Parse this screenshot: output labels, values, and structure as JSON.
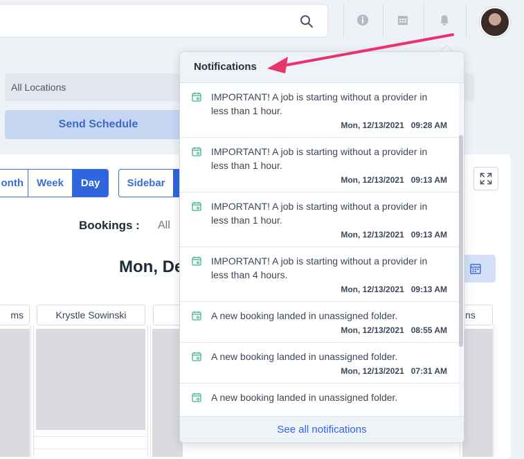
{
  "topbar": {
    "icons": [
      "search-icon",
      "info-icon",
      "calendar-grid-icon",
      "bell-icon"
    ]
  },
  "filters": {
    "location_value": "All Locations",
    "send_schedule_label": "Send Schedule"
  },
  "calendar": {
    "view_tabs": [
      {
        "label": "onth",
        "active": false
      },
      {
        "label": "Week",
        "active": false
      },
      {
        "label": "Day",
        "active": true
      }
    ],
    "sidebar_label": "Sidebar",
    "bookings_label": "Bookings :",
    "bookings_value": "All",
    "date_title": "Mon, De",
    "columns": [
      "ms",
      "Krystle Sowinski",
      "",
      "ns"
    ]
  },
  "notifications": {
    "title": "Notifications",
    "items": [
      {
        "message": "IMPORTANT! A job is starting without a provider in less than 1 hour.",
        "date": "Mon, 12/13/2021",
        "time": "09:28 AM"
      },
      {
        "message": "IMPORTANT! A job is starting without a provider in less than 1 hour.",
        "date": "Mon, 12/13/2021",
        "time": "09:13 AM"
      },
      {
        "message": "IMPORTANT! A job is starting without a provider in less than 1 hour.",
        "date": "Mon, 12/13/2021",
        "time": "09:13 AM"
      },
      {
        "message": "IMPORTANT! A job is starting without a provider in less than 4 hours.",
        "date": "Mon, 12/13/2021",
        "time": "09:13 AM"
      },
      {
        "message": "A new booking landed in unassigned folder.",
        "date": "Mon, 12/13/2021",
        "time": "08:55 AM"
      },
      {
        "message": "A new booking landed in unassigned folder.",
        "date": "Mon, 12/13/2021",
        "time": "07:31 AM"
      },
      {
        "message": "A new booking landed in unassigned folder.",
        "date": "",
        "time": ""
      }
    ],
    "footer_link": "See all notifications"
  },
  "colors": {
    "accent": "#2f66e0",
    "annotation_arrow": "#e8336b",
    "notification_icon": "#3cb38a"
  }
}
